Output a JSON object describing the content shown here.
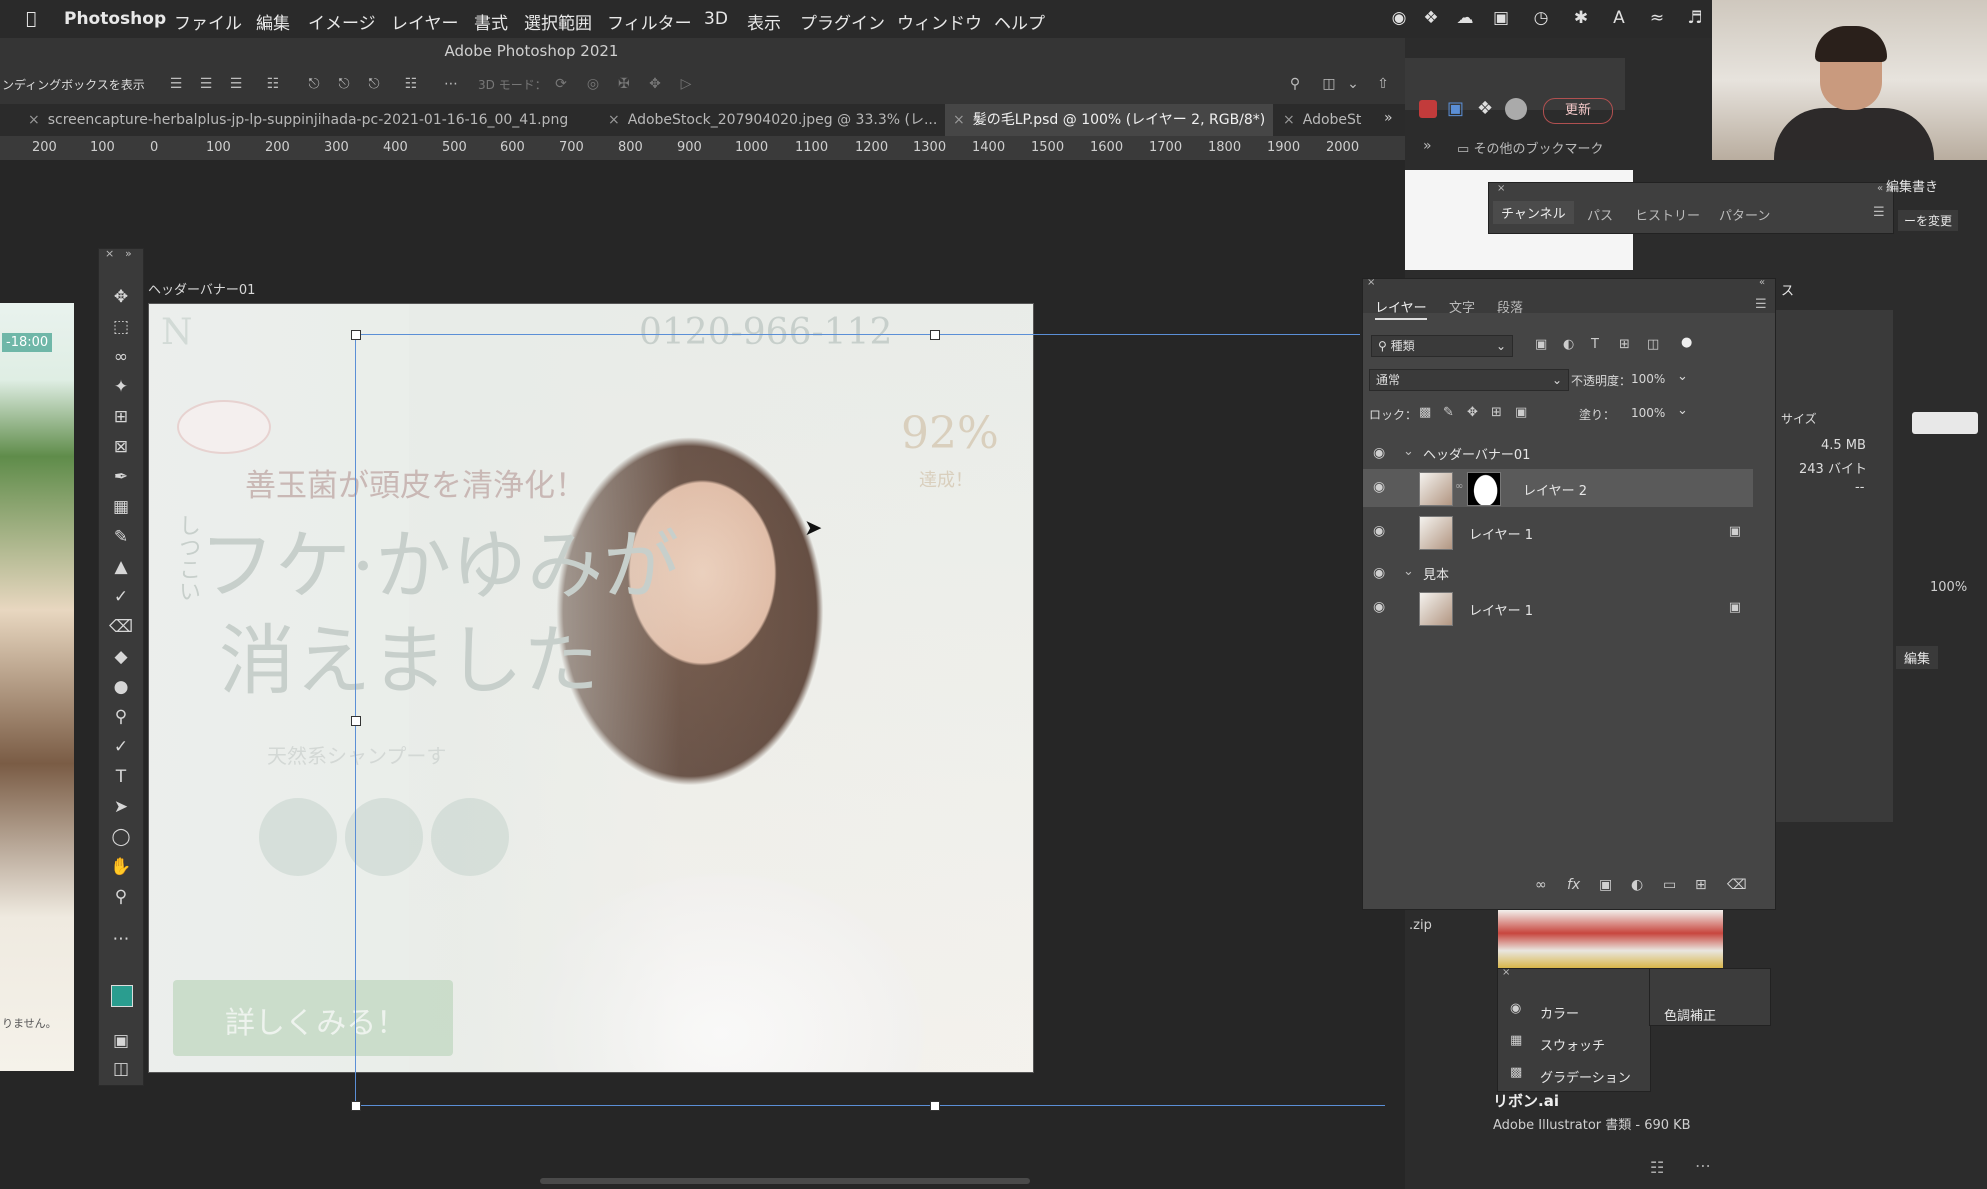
{
  "menubar": {
    "app": "Photoshop",
    "items": [
      "ファイル",
      "編集",
      "イメージ",
      "レイヤー",
      "書式",
      "選択範囲",
      "フィルター",
      "3D",
      "表示",
      "プラグイン",
      "ウィンドウ",
      "ヘルプ"
    ]
  },
  "window": {
    "title": "Adobe Photoshop 2021"
  },
  "options_bar": {
    "bounding_box_label": "ンディングボックスを表示",
    "mode_3d": "3D モード："
  },
  "tabs": [
    {
      "label": "screencapture-herbalplus-jp-lp-suppinjihada-pc-2021-01-16-16_00_41.png"
    },
    {
      "label": "AdobeStock_207904020.jpeg @ 33.3% (レ..."
    },
    {
      "label": "髪の毛LP.psd @ 100% (レイヤー 2, RGB/8*)"
    },
    {
      "label": "AdobeSt"
    }
  ],
  "ruler": [
    "200",
    "100",
    "0",
    "100",
    "200",
    "300",
    "400",
    "500",
    "600",
    "700",
    "800",
    "900",
    "1000",
    "1100",
    "1200",
    "1300",
    "1400",
    "1500",
    "1600",
    "1700",
    "1800",
    "1900",
    "2000"
  ],
  "left_image": {
    "time": "-18:00",
    "tail_text": "りません。"
  },
  "artboard": {
    "name": "ヘッダーバナー01",
    "phone": "0120-966-112",
    "badge": "92%",
    "badge_sub": "達成！",
    "headline1": "善玉菌が頭皮を清浄化！",
    "side_text": "しつこい",
    "headline2": "フケ·かゆみが",
    "headline3": "消えました",
    "sub": "天然系シャンプーす",
    "cta": "詳しくみる！"
  },
  "browser": {
    "update_button": "更新",
    "bookmarks": "その他のブックマーク",
    "zip_label": ".zip"
  },
  "channels_panel": {
    "tabs": [
      "チャンネル",
      "パス",
      "ヒストリー",
      "パターン"
    ],
    "active": "チャンネル"
  },
  "layers_panel": {
    "tabs": [
      "レイヤー",
      "文字",
      "段落"
    ],
    "filter": "種類",
    "blend_mode": "通常",
    "opacity_label": "不透明度：",
    "opacity": "100%",
    "lock_label": "ロック：",
    "fill_label": "塗り：",
    "fill": "100%",
    "groups": [
      {
        "name": "ヘッダーバナー01",
        "layers": [
          {
            "name": "レイヤー 2",
            "selected": true,
            "locked": false
          },
          {
            "name": "レイヤー 1",
            "selected": false,
            "locked": true
          }
        ]
      },
      {
        "name": "見本",
        "layers": [
          {
            "name": "レイヤー 1",
            "selected": false,
            "locked": true
          }
        ]
      }
    ]
  },
  "right_panel": {
    "header": "編集書き",
    "change_button": "ーを変更",
    "section": "ス",
    "size_label": "サイズ",
    "size1": "4.5 MB",
    "size2": "243 バイト",
    "size3": "--",
    "zoom": "100%",
    "edit": "編集"
  },
  "color_menu": {
    "items": [
      "カラー",
      "スウォッチ",
      "グラデーション"
    ]
  },
  "adjust_menu": {
    "label": "色調補正"
  },
  "library": {
    "file_name": "リボン.ai",
    "file_info": "Adobe Illustrator 書類 - 690 KB"
  },
  "colors": {
    "foreground": "#2a9d8f",
    "background": "#ffffff",
    "guide": "#5b8fd6"
  }
}
